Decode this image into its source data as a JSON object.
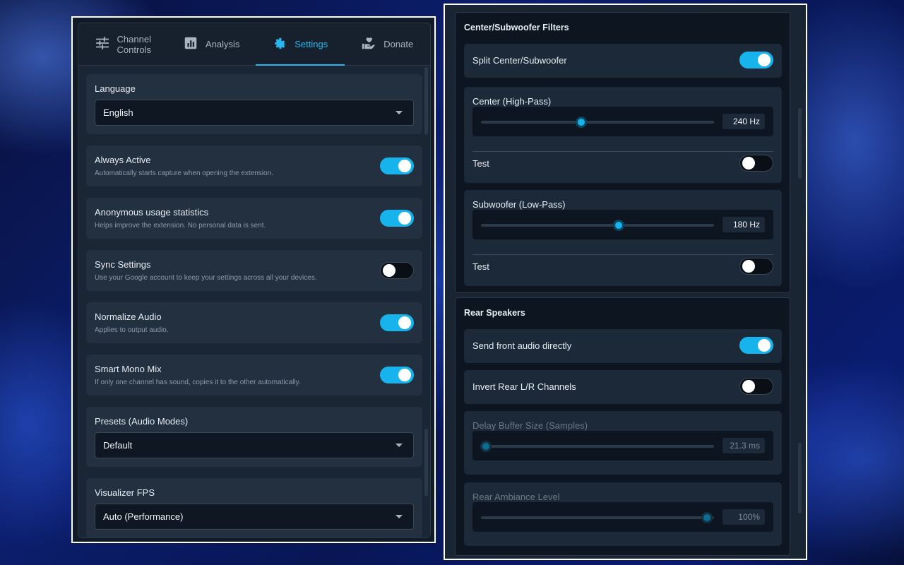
{
  "tabs": {
    "channel_controls": "Channel\nControls",
    "analysis": "Analysis",
    "settings": "Settings",
    "donate": "Donate"
  },
  "settings": {
    "language": {
      "title": "Language",
      "value": "English"
    },
    "always_active": {
      "title": "Always Active",
      "desc": "Automatically starts capture when opening the extension.",
      "on": true
    },
    "usage_stats": {
      "title": "Anonymous usage statistics",
      "desc": "Helps improve the extension. No personal data is sent.",
      "on": true
    },
    "sync_settings": {
      "title": "Sync Settings",
      "desc": "Use your Google account to keep your settings across all your devices.",
      "on": false
    },
    "normalize_audio": {
      "title": "Normalize Audio",
      "desc": "Applies to output audio.",
      "on": true
    },
    "smart_mono": {
      "title": "Smart Mono Mix",
      "desc": "If only one channel has sound, copies it to the other automatically.",
      "on": true
    },
    "presets": {
      "title": "Presets (Audio Modes)",
      "value": "Default"
    },
    "visualizer_fps": {
      "title": "Visualizer FPS",
      "value": "Auto (Performance)"
    }
  },
  "center_sub": {
    "title": "Center/Subwoofer Filters",
    "split_label": "Split Center/Subwoofer",
    "split_on": true,
    "center_label": "Center (High-Pass)",
    "center_value": "240 Hz",
    "center_fraction": 0.43,
    "center_test_label": "Test",
    "center_test_on": false,
    "sub_label": "Subwoofer (Low-Pass)",
    "sub_value": "180 Hz",
    "sub_fraction": 0.59,
    "sub_test_label": "Test",
    "sub_test_on": false
  },
  "rear": {
    "title": "Rear Speakers",
    "send_front_label": "Send front audio directly",
    "send_front_on": true,
    "invert_label": "Invert Rear L/R Channels",
    "invert_on": false,
    "delay_label": "Delay Buffer Size (Samples)",
    "delay_value": "21.3 ms",
    "delay_fraction": 0.02,
    "ambiance_label": "Rear Ambiance Level",
    "ambiance_value": "100%",
    "ambiance_fraction": 0.97
  },
  "colors": {
    "accent": "#16b3ec",
    "panel": "#1b2635",
    "card": "#223040"
  }
}
